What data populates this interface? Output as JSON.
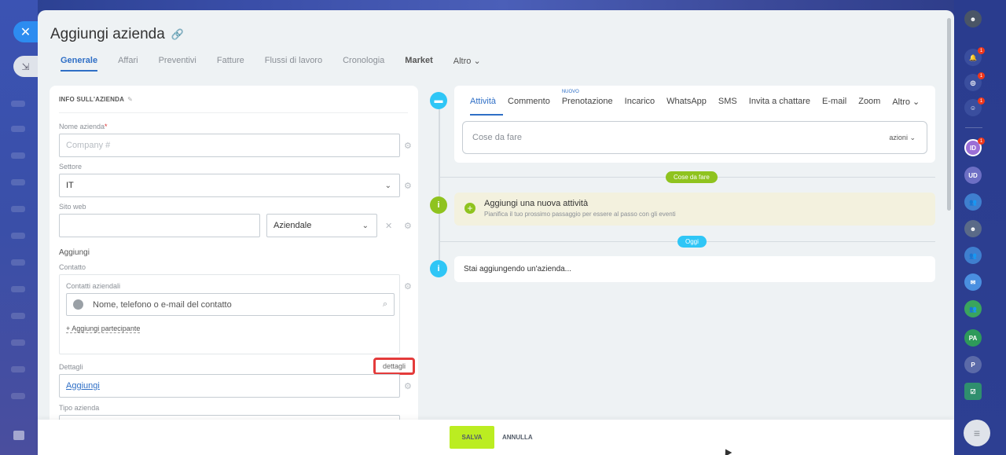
{
  "window": {
    "title": "Aggiungi azienda"
  },
  "tabs": [
    "Generale",
    "Affari",
    "Preventivi",
    "Fatture",
    "Flussi di lavoro",
    "Cronologia",
    "Market",
    "Altro"
  ],
  "card": {
    "header": "INFO SULL'AZIENDA",
    "name_label": "Nome azienda",
    "name_required": "*",
    "name_placeholder": "Company #",
    "sector_label": "Settore",
    "sector_value": "IT",
    "website_label": "Sito web",
    "website_value": "",
    "website_type": "Aziendale",
    "add_label": "Aggiungi",
    "contact_label": "Contatto",
    "company_contacts_label": "Contatti aziendali",
    "contact_search_placeholder": "Nome, telefono o e-mail del contatto",
    "add_participant": "+ Aggiungi partecipante",
    "details_label": "Dettagli",
    "details_button": "dettagli",
    "details_add": "Aggiungi",
    "company_type_label": "Tipo azienda"
  },
  "timeline": {
    "editor_tabs": [
      "Attività",
      "Commento",
      "Prenotazione",
      "Incarico",
      "WhatsApp",
      "SMS",
      "Invita a chattare",
      "E-mail",
      "Zoom",
      "Altro"
    ],
    "new_badge": "NUOVO",
    "todo_placeholder": "Cose da fare",
    "actions": "azioni",
    "todo_pill": "Cose da fare",
    "new_activity_title": "Aggiungi una nuova attività",
    "new_activity_sub": "Pianifica il tuo prossimo passaggio per essere al passo con gli eventi",
    "today_pill": "Oggi",
    "info_text": "Stai aggiungendo un'azienda..."
  },
  "footer": {
    "save": "SALVA",
    "cancel": "ANNULLA"
  },
  "right_bar": {
    "badges": [
      "1",
      "1",
      "1",
      "1"
    ],
    "avatars": [
      "ID",
      "UD",
      "PA",
      "P"
    ]
  },
  "colors": {
    "accent": "#2f6fc6",
    "save_green": "#bbed21",
    "highlight_red": "#e43b3b",
    "timeline_green": "#8fc31f",
    "timeline_blue": "#2fc6f6"
  }
}
